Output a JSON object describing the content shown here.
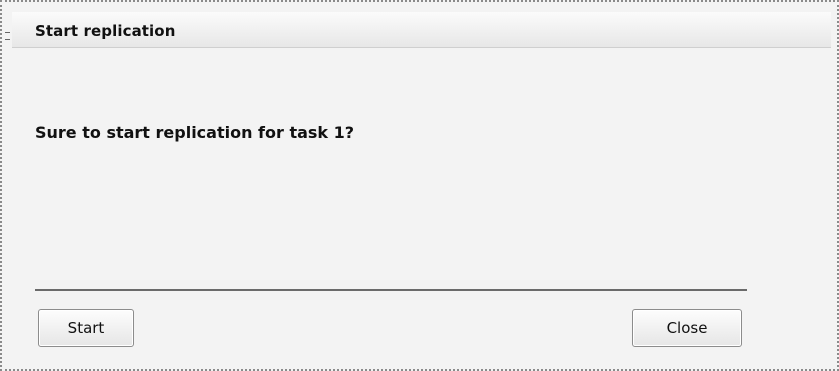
{
  "dialog": {
    "title": "Start replication",
    "message": "Sure to start replication for task 1?",
    "buttons": {
      "start_label": "Start",
      "close_label": "Close"
    }
  }
}
